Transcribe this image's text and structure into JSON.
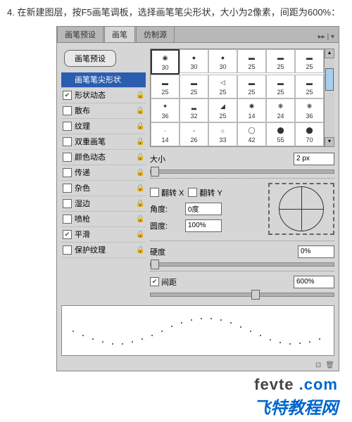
{
  "instruction": "4. 在新建图层，按F5画笔调板，选择画笔笔尖形状，大小为2像素，间距为600%：",
  "tabs": {
    "t0": "画笔预设",
    "t1": "画笔",
    "t2": "仿制源"
  },
  "preset_button": "画笔预设",
  "options": {
    "header": "画笔笔尖形状",
    "o1": "形状动态",
    "o2": "散布",
    "o3": "纹理",
    "o4": "双重画笔",
    "o5": "颜色动态",
    "o6": "传递",
    "o7": "杂色",
    "o8": "湿边",
    "o9": "喷枪",
    "o10": "平滑",
    "o11": "保护纹理"
  },
  "checks": {
    "o1": true,
    "o2": false,
    "o3": false,
    "o4": false,
    "o5": false,
    "o6": false,
    "o7": false,
    "o8": false,
    "o9": false,
    "o10": true,
    "o11": false
  },
  "brushes": [
    "30",
    "30",
    "30",
    "25",
    "25",
    "25",
    "25",
    "25",
    "25",
    "25",
    "25",
    "25",
    "36",
    "32",
    "25",
    "14",
    "24",
    "36",
    "14",
    "26",
    "33",
    "42",
    "55",
    "70"
  ],
  "props": {
    "size_label": "大小",
    "size_value": "2 px",
    "flipx": "翻转 X",
    "flipy": "翻转 Y",
    "angle_label": "角度:",
    "angle_value": "0度",
    "round_label": "圆度:",
    "round_value": "100%",
    "hard_label": "硬度",
    "hard_value": "0%",
    "spacing_label": "间距",
    "spacing_value": "600%",
    "spacing_checked": true
  },
  "watermark": {
    "line1a": "fevte",
    "line1b": ".com",
    "line2": "飞特教程网"
  }
}
